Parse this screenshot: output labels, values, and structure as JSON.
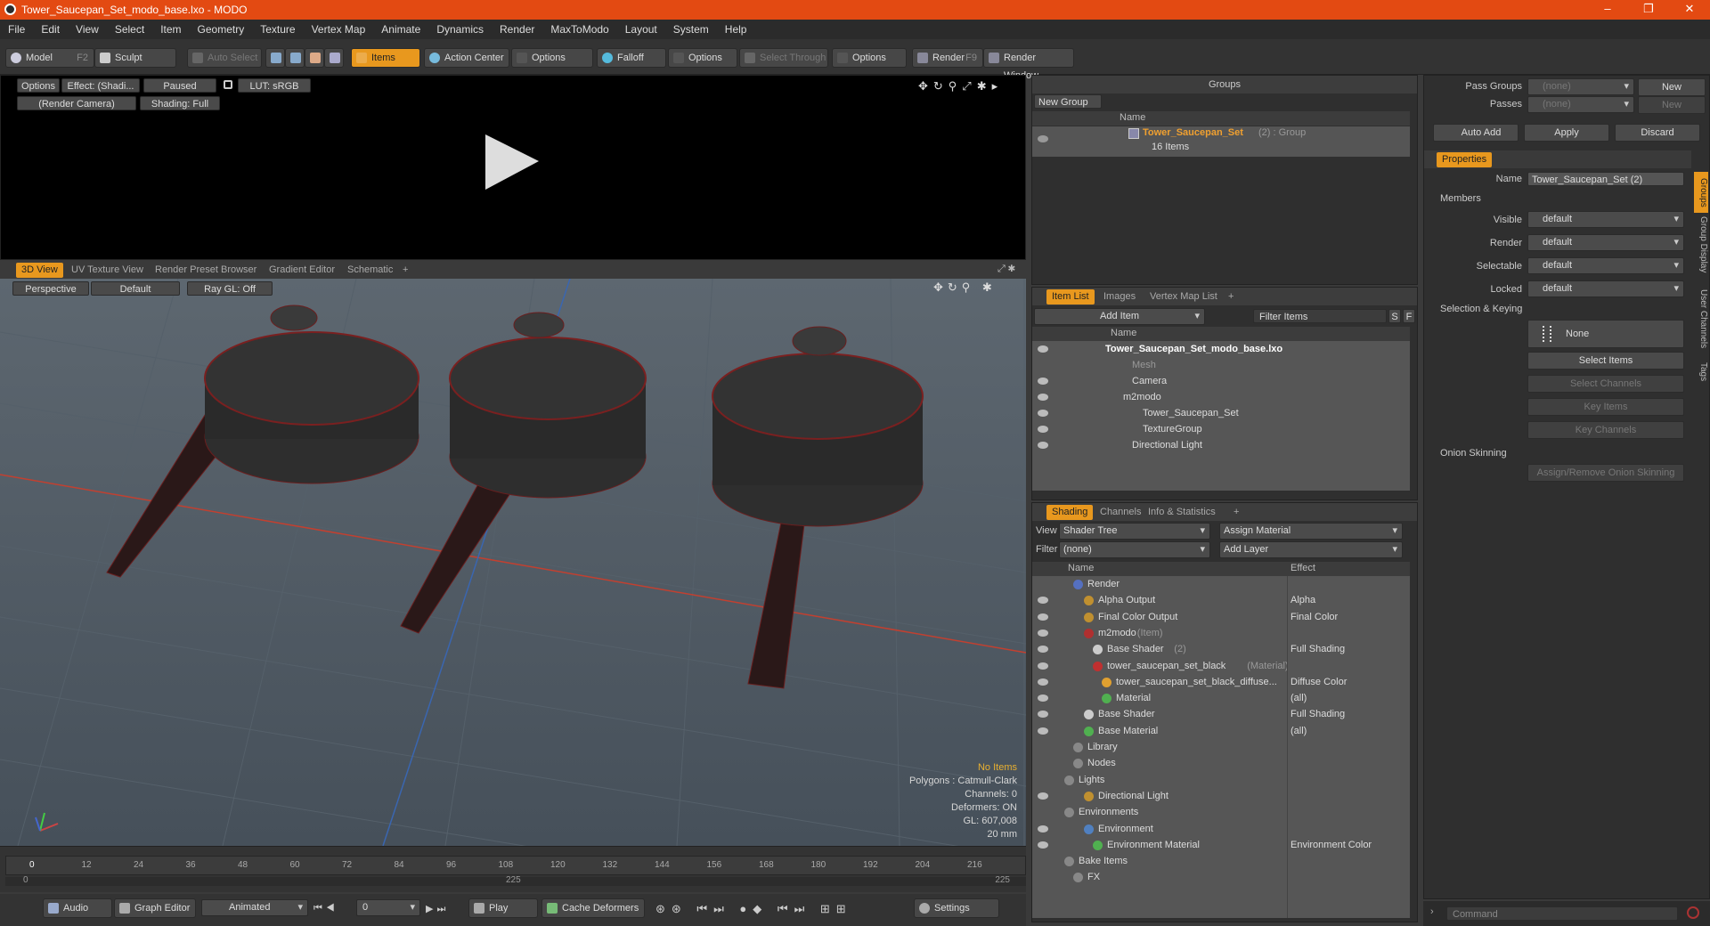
{
  "window": {
    "title": "Tower_Saucepan_Set_modo_base.lxo - MODO",
    "minimize": "–",
    "restore": "❐",
    "close": "✕"
  },
  "menu": [
    "File",
    "Edit",
    "View",
    "Select",
    "Item",
    "Geometry",
    "Texture",
    "Vertex Map",
    "Animate",
    "Dynamics",
    "Render",
    "MaxToModo",
    "Layout",
    "System",
    "Help"
  ],
  "toolbar": {
    "model": "Model",
    "model_key": "F2",
    "sculpt": "Sculpt",
    "auto_select": "Auto Select",
    "items": "Items",
    "action_center": "Action Center",
    "options1": "Options",
    "falloff": "Falloff",
    "options2": "Options",
    "select_through": "Select Through",
    "options3": "Options",
    "render": "Render",
    "render_key": "F9",
    "render_window": "Render Window"
  },
  "render_view": {
    "options": "Options",
    "effect": "Effect: (Shadi...",
    "paused": "Paused",
    "lut": "LUT: sRGB",
    "camera": "(Render Camera)",
    "shading": "Shading: Full"
  },
  "view_tabs": [
    "3D View",
    "UV Texture View",
    "Render Preset Browser",
    "Gradient Editor",
    "Schematic",
    "+"
  ],
  "viewport": {
    "perspective": "Perspective",
    "default": "Default",
    "raygl": "Ray GL: Off",
    "stats": {
      "no_items": "No Items",
      "polygons": "Polygons : Catmull-Clark",
      "channels": "Channels: 0",
      "deformers": "Deformers: ON",
      "gl": "GL: 607,008",
      "size": "20 mm"
    }
  },
  "timeline": {
    "ticks": [
      "0",
      "12",
      "24",
      "36",
      "48",
      "60",
      "72",
      "84",
      "96",
      "108",
      "120",
      "132",
      "144",
      "156",
      "168",
      "180",
      "192",
      "204",
      "216"
    ],
    "sub_left": "0",
    "sub_mid": "225",
    "sub_right": "225"
  },
  "bottombar": {
    "audio": "Audio",
    "graph_editor": "Graph Editor",
    "animated": "Animated",
    "frame": "0",
    "play": "Play",
    "cache": "Cache Deformers",
    "settings": "Settings",
    "command": "Command"
  },
  "groups": {
    "title": "Groups",
    "new_group": "New Group",
    "name_header": "Name",
    "item_name": "Tower_Saucepan_Set",
    "item_suffix": "(2) : Group",
    "item_count": "16 Items"
  },
  "item_list": {
    "tabs": [
      "Item List",
      "Images",
      "Vertex Map List",
      "+"
    ],
    "add_item": "Add Item",
    "filter": "Filter Items",
    "s": "S",
    "f": "F",
    "name_header": "Name",
    "rows": [
      "Tower_Saucepan_Set_modo_base.lxo",
      "Mesh",
      "Camera",
      "m2modo",
      "Tower_Saucepan_Set",
      "TextureGroup",
      "Directional Light"
    ]
  },
  "shading": {
    "tabs": [
      "Shading",
      "Channels",
      "Info & Statistics",
      "+"
    ],
    "view_label": "View",
    "view_value": "Shader Tree",
    "assign": "Assign Material",
    "filter_label": "Filter",
    "filter_value": "(none)",
    "add_layer": "Add Layer",
    "name_header": "Name",
    "effect_header": "Effect",
    "rows": [
      {
        "name": "Render",
        "effect": ""
      },
      {
        "name": "Alpha Output",
        "effect": "Alpha"
      },
      {
        "name": "Final Color Output",
        "effect": "Final Color"
      },
      {
        "name": "m2modo",
        "suffix": "(Item)",
        "effect": ""
      },
      {
        "name": "Base Shader",
        "suffix": "(2)",
        "effect": "Full Shading"
      },
      {
        "name": "tower_saucepan_set_black",
        "suffix": "(Material)",
        "effect": ""
      },
      {
        "name": "tower_saucepan_set_black_diffuse...",
        "effect": "Diffuse Color"
      },
      {
        "name": "Material",
        "effect": "(all)"
      },
      {
        "name": "Base Shader",
        "effect": "Full Shading"
      },
      {
        "name": "Base Material",
        "effect": "(all)"
      },
      {
        "name": "Library",
        "effect": ""
      },
      {
        "name": "Nodes",
        "effect": ""
      },
      {
        "name": "Lights",
        "effect": ""
      },
      {
        "name": "Directional Light",
        "effect": ""
      },
      {
        "name": "Environments",
        "effect": ""
      },
      {
        "name": "Environment",
        "effect": ""
      },
      {
        "name": "Environment Material",
        "effect": "Environment Color"
      },
      {
        "name": "Bake Items",
        "effect": ""
      },
      {
        "name": "FX",
        "effect": ""
      }
    ]
  },
  "right": {
    "pass_groups": "Pass Groups",
    "passes": "Passes",
    "none": "(none)",
    "new": "New",
    "auto_add": "Auto Add",
    "apply": "Apply",
    "discard": "Discard",
    "properties": "Properties",
    "name_label": "Name",
    "name_value": "Tower_Saucepan_Set (2)",
    "members": "Members",
    "visible": "Visible",
    "render": "Render",
    "selectable": "Selectable",
    "locked": "Locked",
    "default": "default",
    "sel_keying": "Selection & Keying",
    "none_btn": "None",
    "select_items": "Select Items",
    "select_channels": "Select Channels",
    "key_items": "Key Items",
    "key_channels": "Key Channels",
    "onion": "Onion Skinning",
    "assign_onion": "Assign/Remove Onion Skinning",
    "side_tabs": [
      "Groups",
      "Group Display",
      "User Channels",
      "Tags"
    ]
  }
}
